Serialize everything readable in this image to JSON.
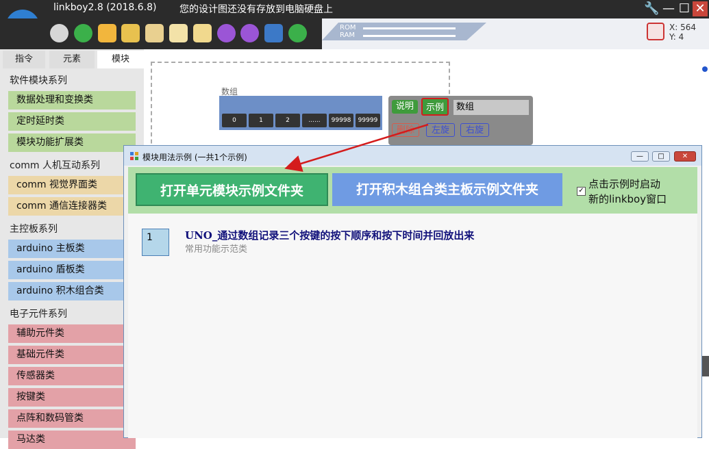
{
  "window": {
    "app_title": "linkboy2.8 (2018.6.8)",
    "status_message": "您的设计图还没有存放到电脑硬盘上",
    "controls": [
      "🔧",
      "—",
      "☐",
      "✕"
    ]
  },
  "toolbar": {
    "memory": {
      "rom_label": "ROM",
      "ram_label": "RAM",
      "rom_usage": 0.9,
      "ram_usage": 0.9
    },
    "coords": {
      "x": "X: 564",
      "y": "Y: 4"
    }
  },
  "sidebar": {
    "tabs": [
      "指令",
      "元素",
      "模块"
    ],
    "categories": {
      "software": "软件模块系列",
      "comm": "comm 人机互动系列",
      "mainboard": "主控板系列",
      "electronic": "电子元件系列"
    },
    "software_items": [
      "数据处理和变换类",
      "定时延时类",
      "模块功能扩展类"
    ],
    "comm_items": [
      "comm 视觉界面类",
      "comm 通信连接器类"
    ],
    "mainboard_items": [
      "arduino 主板类",
      "arduino 盾板类",
      "arduino 积木组合类"
    ],
    "electronic_items": [
      "辅助元件类",
      "基础元件类",
      "传感器类",
      "按键类",
      "点阵和数码管类",
      "马达类"
    ]
  },
  "canvas": {
    "array_label": "数组",
    "array_cells": [
      "0",
      "1",
      "2",
      "......",
      "99998",
      "99999"
    ],
    "module_buttons": {
      "explain": "说明",
      "example": "示例",
      "delete": "删除",
      "rotate_left": "左旋",
      "rotate_right": "右旋"
    },
    "module_name": "数组"
  },
  "dialog": {
    "title": "模块用法示例 (一共1个示例)",
    "open_unit_button": "打开单元模块示例文件夹",
    "open_board_button": "打开积木组合类主板示例文件夹",
    "launch_checkbox_label_line1": "点击示例时启动",
    "launch_checkbox_label_line2": "新的linkboy窗口",
    "launch_checked": true,
    "examples": [
      {
        "index": "1",
        "title": "UNO_通过数组记录三个按键的按下顺序和按下时间并回放出来",
        "subtitle": "常用功能示范类"
      }
    ]
  }
}
